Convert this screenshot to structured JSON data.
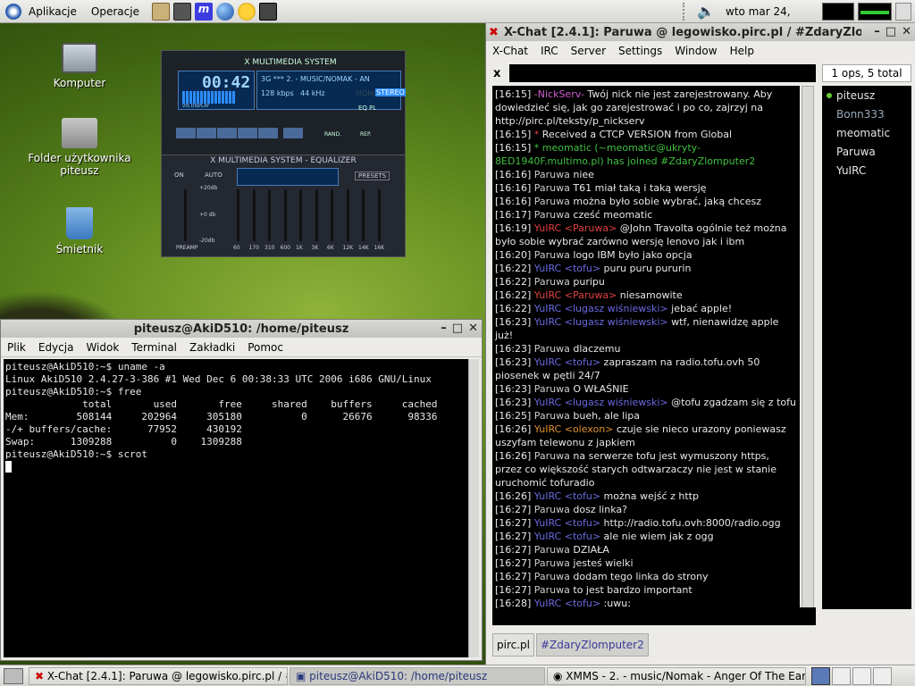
{
  "panel": {
    "applications": "Aplikacje",
    "places": "Operacje",
    "clock": "wto mar 24, 16:28"
  },
  "desktop": {
    "icons": [
      "Komputer",
      "Folder użytkownika piteusz",
      "Śmietnik"
    ]
  },
  "xmms": {
    "time": "00:42",
    "title": "X MULTIMEDIA SYSTEM",
    "track": "3G *** 2. - MUSIC/NOMAK - AN",
    "bitrate": "128 kbps",
    "khz": "44 kHz",
    "mono": "MONO",
    "stereo": "STEREO",
    "vis": "VIS DISPLAY",
    "eq_title": "X MULTIMEDIA SYSTEM - EQUALIZER",
    "on": "ON",
    "auto": "AUTO",
    "presets": "PRESETS",
    "db_top": "+20db",
    "db_mid": "+0 db",
    "db_bot": "-20db",
    "preamp": "PREAMP",
    "bands": [
      "60",
      "170",
      "310",
      "600",
      "1K",
      "3K",
      "6K",
      "12K",
      "14K",
      "16K"
    ],
    "rand": "RAND.",
    "rep": "REP.",
    "eq_btn": "EQ",
    "pl_btn": "PL"
  },
  "terminal": {
    "title": "piteusz@AkiD510: /home/piteusz",
    "menu": [
      "Plik",
      "Edycja",
      "Widok",
      "Terminal",
      "Zakładki",
      "Pomoc"
    ],
    "lines": [
      "piteusz@AkiD510:~$ uname -a",
      "Linux AkiD510 2.4.27-3-386 #1 Wed Dec 6 00:38:33 UTC 2006 i686 GNU/Linux",
      "piteusz@AkiD510:~$ free",
      "             total       used       free     shared    buffers     cached",
      "Mem:        508144     202964     305180          0      26676      98336",
      "-/+ buffers/cache:      77952     430192",
      "Swap:      1309288          0    1309288",
      "piteusz@AkiD510:~$ scrot"
    ]
  },
  "xchat": {
    "title": "X-Chat [2.4.1]: Paruwa @ legowisko.pirc.pl / #ZdaryZlo",
    "menu": [
      "X-Chat",
      "IRC",
      "Server",
      "Settings",
      "Window",
      "Help"
    ],
    "ops": "1 ops, 5 total",
    "nick": "Paruwa",
    "close": "x",
    "users": [
      "piteusz",
      "Bonn333",
      "meomatic",
      "Paruwa",
      "YuIRC"
    ],
    "tabs": [
      "pirc.pl",
      "#ZdaryZlomputer2"
    ],
    "messages": [
      {
        "t": "[16:15]",
        "n": "-NickServ-",
        "nc": "#d060d0",
        "m": "Twój nick nie jest zarejestrowany. Aby dowiedzieć się, jak go zarejestrować i po co, zajrzyj na http://pirc.pl/teksty/p_nickserv"
      },
      {
        "t": "[16:15]",
        "n": "*",
        "nc": "#e04040",
        "m": "Received a CTCP VERSION from Global"
      },
      {
        "t": "[16:15]",
        "n": "* meomatic",
        "nc": "#40c040",
        "m": "(~meomatic@ukryty-8ED1940F.multimo.pl) has joined #ZdaryZlomputer2",
        "mc": "#40c040"
      },
      {
        "t": "[16:16]",
        "n": "Paruwa",
        "nc": "#cccccc",
        "m": "niee"
      },
      {
        "t": "[16:16]",
        "n": "Paruwa",
        "nc": "#cccccc",
        "m": "T61 miał taką i taką wersję"
      },
      {
        "t": "[16:16]",
        "n": "Paruwa",
        "nc": "#cccccc",
        "m": "można było sobie wybrać, jaką chcesz"
      },
      {
        "t": "[16:17]",
        "n": "Paruwa",
        "nc": "#cccccc",
        "m": "cześć meomatic"
      },
      {
        "t": "[16:19]",
        "n": "YuIRC <Paruwa>",
        "nc": "#e04040",
        "m": "@John Travolta ogólnie też można było sobie wybrać zarówno wersję lenovo jak i ibm"
      },
      {
        "t": "[16:20]",
        "n": "Paruwa",
        "nc": "#cccccc",
        "m": "logo IBM było jako opcja"
      },
      {
        "t": "[16:22]",
        "n": "YuIRC <tofu>",
        "nc": "#6a6ae0",
        "m": "puru puru pururin"
      },
      {
        "t": "[16:22]",
        "n": "Paruwa",
        "nc": "#cccccc",
        "m": "puripu"
      },
      {
        "t": "[16:22]",
        "n": "YuIRC <Paruwa>",
        "nc": "#e04040",
        "m": "niesamowite"
      },
      {
        "t": "[16:22]",
        "n": "YuIRC <lugasz wiśniewski>",
        "nc": "#6a6ae0",
        "m": "jebać apple!"
      },
      {
        "t": "[16:23]",
        "n": "YuIRC <lugasz wiśniewski>",
        "nc": "#6a6ae0",
        "m": "wtf, nienawidzę apple już!"
      },
      {
        "t": "[16:23]",
        "n": "Paruwa",
        "nc": "#cccccc",
        "m": "dlaczemu"
      },
      {
        "t": "[16:23]",
        "n": "YuIRC <tofu>",
        "nc": "#6a6ae0",
        "m": "zapraszam na radio.tofu.ovh 50 piosenek w pętli 24/7"
      },
      {
        "t": "[16:23]",
        "n": "Paruwa",
        "nc": "#cccccc",
        "m": "O WŁAŚNIE"
      },
      {
        "t": "[16:23]",
        "n": "YuIRC <lugasz wiśniewski>",
        "nc": "#6a6ae0",
        "m": "@tofu zgadzam się z tofu"
      },
      {
        "t": "[16:25]",
        "n": "Paruwa",
        "nc": "#cccccc",
        "m": "bueh, ale lipa"
      },
      {
        "t": "[16:26]",
        "n": "YuIRC <olexon>",
        "nc": "#e09030",
        "m": "czuje sie nieco urazony poniewasz uszyfam telewonu z japkiem"
      },
      {
        "t": "[16:26]",
        "n": "Paruwa",
        "nc": "#cccccc",
        "m": "na serwerze tofu jest wymuszony https, przez co większość starych odtwarzaczy nie jest w stanie uruchomić tofuradio"
      },
      {
        "t": "[16:26]",
        "n": "YuIRC <tofu>",
        "nc": "#6a6ae0",
        "m": "można wejść z http"
      },
      {
        "t": "[16:27]",
        "n": "Paruwa",
        "nc": "#cccccc",
        "m": "dosz linka?"
      },
      {
        "t": "[16:27]",
        "n": "YuIRC <tofu>",
        "nc": "#6a6ae0",
        "m": "http://radio.tofu.ovh:8000/radio.ogg"
      },
      {
        "t": "[16:27]",
        "n": "YuIRC <tofu>",
        "nc": "#6a6ae0",
        "m": "ale nie wiem jak z ogg"
      },
      {
        "t": "[16:27]",
        "n": "Paruwa",
        "nc": "#cccccc",
        "m": "DZIAŁA"
      },
      {
        "t": "[16:27]",
        "n": "Paruwa",
        "nc": "#cccccc",
        "m": "jesteś wielki"
      },
      {
        "t": "[16:27]",
        "n": "Paruwa",
        "nc": "#cccccc",
        "m": "dodam tego linka do strony"
      },
      {
        "t": "[16:27]",
        "n": "Paruwa",
        "nc": "#cccccc",
        "m": "to jest bardzo important"
      },
      {
        "t": "[16:28]",
        "n": "YuIRC <tofu>",
        "nc": "#6a6ae0",
        "m": ":uwu:"
      }
    ]
  },
  "taskbar": [
    "X-Chat [2.4.1]: Paruwa @ legowisko.pirc.pl / #Z",
    "piteusz@AkiD510: /home/piteusz",
    "XMMS - 2.  - music/Nomak - Anger Of The Earth.o"
  ]
}
